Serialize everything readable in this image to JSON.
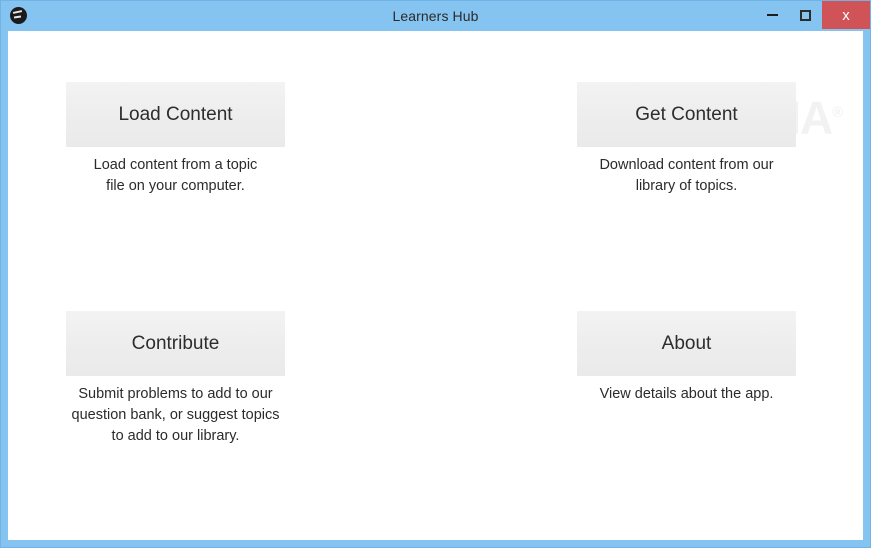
{
  "window": {
    "title": "Learners Hub",
    "icon": "graduation-cap-icon",
    "frame_color": "#85c3f0",
    "close_button_color": "#cf5357",
    "controls": {
      "minimize_label": "",
      "maximize_label": "",
      "close_label": "x"
    }
  },
  "watermark": {
    "text": "SOFTPEDIA",
    "registered_mark": "®"
  },
  "main": {
    "cards": [
      {
        "id": "load-content",
        "button_label": "Load Content",
        "description": "Load content from a topic\nfile on your computer."
      },
      {
        "id": "get-content",
        "button_label": "Get Content",
        "description": "Download content from our\nlibrary of topics."
      },
      {
        "id": "contribute",
        "button_label": "Contribute",
        "description": "Submit problems to add to our\nquestion bank, or suggest topics\nto add to our library."
      },
      {
        "id": "about",
        "button_label": "About",
        "description": "View details about the app."
      }
    ]
  }
}
